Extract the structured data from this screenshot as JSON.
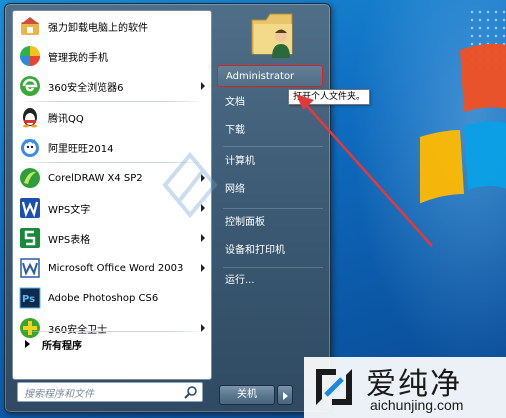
{
  "programs": [
    {
      "label": "强力卸载电脑上的软件",
      "icon": "uninstall-icon",
      "arrow": false
    },
    {
      "label": "管理我的手机",
      "icon": "phone-manager-icon",
      "arrow": false
    },
    {
      "label": "360安全浏览器6",
      "icon": "browser-icon",
      "arrow": true
    },
    {
      "label": "腾讯QQ",
      "icon": "qq-penguin-icon",
      "arrow": false
    },
    {
      "label": "阿里旺旺2014",
      "icon": "wangwang-icon",
      "arrow": false
    },
    {
      "label": "CorelDRAW X4 SP2",
      "icon": "coreldraw-icon",
      "arrow": true
    },
    {
      "label": "WPS文字",
      "icon": "wps-writer-icon",
      "arrow": true
    },
    {
      "label": "WPS表格",
      "icon": "wps-spreadsheet-icon",
      "arrow": true
    },
    {
      "label": "Microsoft Office Word 2003",
      "icon": "word-icon",
      "arrow": true
    },
    {
      "label": "Adobe Photoshop CS6",
      "icon": "photoshop-icon",
      "arrow": false
    },
    {
      "label": "360安全卫士",
      "icon": "security-guard-icon",
      "arrow": true
    }
  ],
  "all_programs_label": "所有程序",
  "search_placeholder": "搜索程序和文件",
  "right_pane": {
    "user": "Administrator",
    "documents": "文档",
    "downloads": "下载",
    "computer": "计算机",
    "network": "网络",
    "control_panel": "控制面板",
    "devices_printers": "设备和打印机",
    "run": "运行..."
  },
  "shutdown_label": "关机",
  "tooltip": "打开个人文件夹。",
  "watermark": {
    "title": "爱纯净",
    "url": "aichunjing.com"
  },
  "colors": {
    "highlight_border": "#e02020",
    "arrow": "#e23a3a",
    "menu_bg": "#3c5a74",
    "desktop": "#0f6cc0"
  }
}
